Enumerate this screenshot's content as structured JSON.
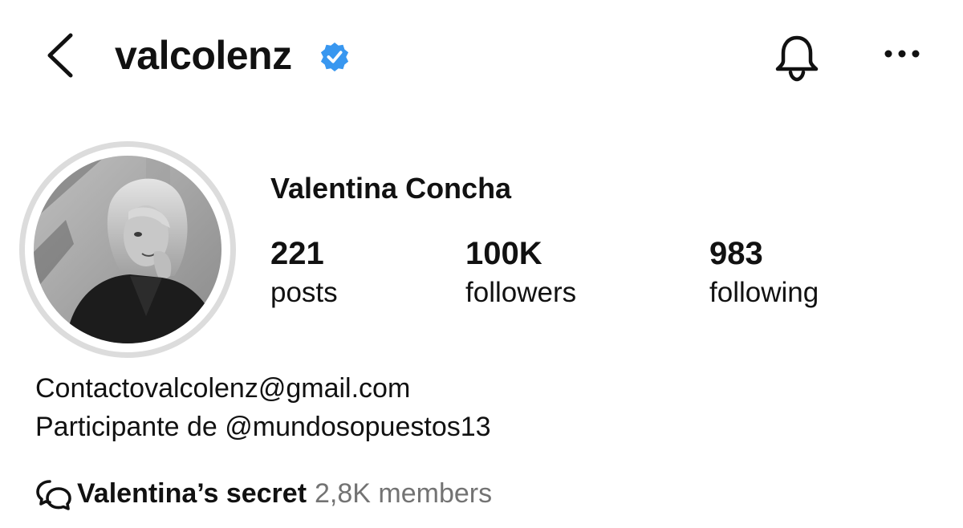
{
  "header": {
    "username": "valcolenz",
    "verified": true,
    "icons": [
      "back-chevron-icon",
      "verified-badge-icon",
      "bell-icon",
      "more-horizontal-icon"
    ]
  },
  "profile": {
    "display_name": "Valentina Concha",
    "stats": [
      {
        "value": "221",
        "label": "posts"
      },
      {
        "value": "100K",
        "label": "followers"
      },
      {
        "value": "983",
        "label": "following"
      }
    ],
    "bio": [
      "Contactovalcolenz@gmail.com",
      "Participante de @mundosopuestos13"
    ],
    "channel": {
      "name": "Valentina’s secret",
      "members": "2,8K members",
      "icon": "broadcast-chat-icon"
    }
  },
  "colors": {
    "text": "#111111",
    "muted": "#737373",
    "verified_blue": "#3897f0",
    "avatar_ring": "#dcdcdc"
  }
}
